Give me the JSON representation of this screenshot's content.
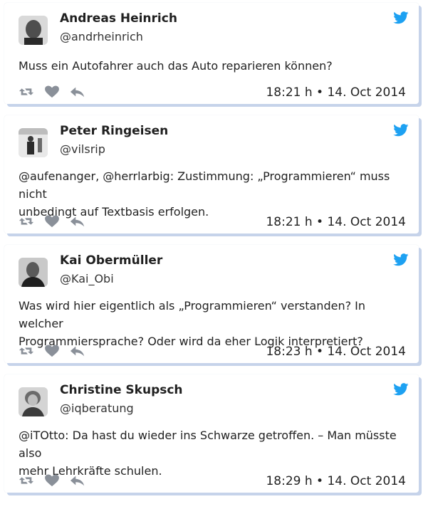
{
  "tweets": [
    {
      "name": "Andreas Heinrich",
      "handle": "@andrheinrich",
      "text_lines": [
        "Muss ein Autofahrer auch das Auto reparieren können?"
      ],
      "time": "18:21 h • 14. Oct 2014",
      "avatar_icon": "avatar-bald-man"
    },
    {
      "name": "Peter Ringeisen",
      "handle": "@vilsrip",
      "text_lines": [
        "@aufenanger, @herrlarbig: Zustimmung: „Programmieren“ muss nicht",
        "unbedingt auf Textbasis erfolgen."
      ],
      "time": "18:21 h • 14. Oct 2014",
      "avatar_icon": "avatar-standing-figure"
    },
    {
      "name": "Kai Obermüller",
      "handle": "@Kai_Obi",
      "text_lines": [
        "Was wird hier eigentlich als „Programmieren“ verstanden? In welcher",
        "Programmiersprache? Oder wird da eher Logik interpretiert?"
      ],
      "time": "18:23 h • 14. Oct 2014",
      "avatar_icon": "avatar-man-portrait"
    },
    {
      "name": "Christine Skupsch",
      "handle": "@iqberatung",
      "text_lines": [
        "@iTOtto: Da hast du wieder ins Schwarze getroffen. – Man müsste also",
        "mehr Lehrkräfte schulen."
      ],
      "time": "18:29 h • 14. Oct 2014",
      "avatar_icon": "avatar-woman-portrait"
    }
  ],
  "colors": {
    "twitter_blue": "#1da1f2",
    "action_gray": "#8a9099",
    "shadow": "#c6d3ea"
  }
}
